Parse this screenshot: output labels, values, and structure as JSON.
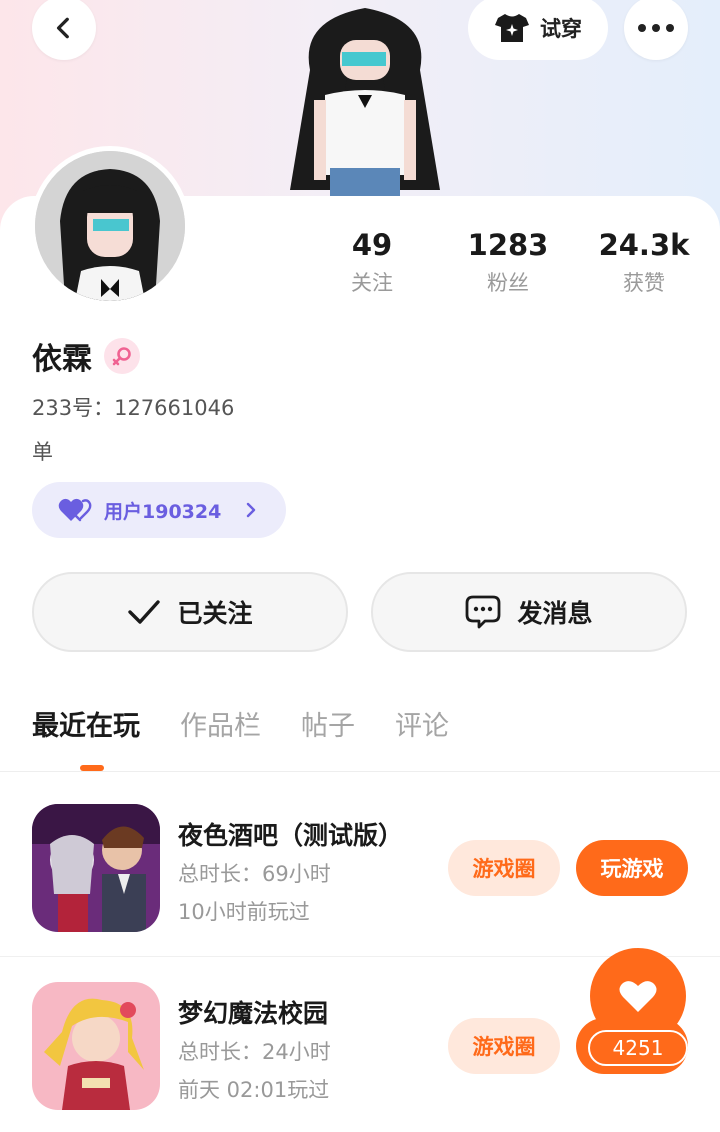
{
  "header": {
    "back_icon": "chevron-left-icon",
    "tryon_label": "试穿",
    "tryon_icon": "shirt-sparkle-icon",
    "more_icon": "more-dots-icon"
  },
  "profile": {
    "name": "依霖",
    "gender_icon": "female-icon",
    "id_text": "233号：127661046",
    "bio": "单",
    "relation_label": "用户190324"
  },
  "stats": [
    {
      "value": "49",
      "label": "关注"
    },
    {
      "value": "1283",
      "label": "粉丝"
    },
    {
      "value": "24.3k",
      "label": "获赞"
    }
  ],
  "actions": {
    "follow_label": "已关注",
    "message_label": "发消息"
  },
  "tabs": [
    {
      "label": "最近在玩",
      "active": true
    },
    {
      "label": "作品栏",
      "active": false
    },
    {
      "label": "帖子",
      "active": false
    },
    {
      "label": "评论",
      "active": false
    }
  ],
  "games": [
    {
      "title": "夜色酒吧（测试版）",
      "playtime": "总时长：69小时",
      "last_played": "10小时前玩过",
      "circle_label": "游戏圈",
      "play_label": "玩游戏"
    },
    {
      "title": "梦幻魔法校园",
      "playtime": "总时长：24小时",
      "last_played": "前天 02:01玩过",
      "circle_label": "游戏圈"
    }
  ],
  "floating_like": {
    "count": "4251",
    "icon": "heart-icon"
  },
  "colors": {
    "accent": "#ff6a1a",
    "relation": "#6a5ee0",
    "female": "#f06292"
  }
}
